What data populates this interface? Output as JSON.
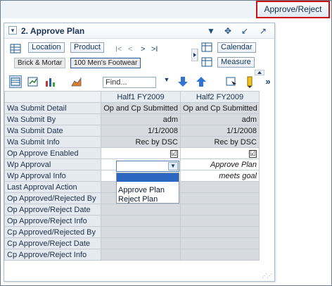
{
  "top_bar": {
    "approve_reject_label": "Approve/Reject"
  },
  "panel": {
    "title": "2. Approve Plan",
    "toolbar": {
      "location_label": "Location",
      "product_label": "Product",
      "calendar_label": "Calendar",
      "measure_label": "Measure",
      "context_chips": [
        "Brick & Mortar",
        "100 Men's Footwear"
      ],
      "find_placeholder": "Find..."
    },
    "grid": {
      "columns": [
        "Half1 FY2009",
        "Half2 FY2009"
      ],
      "rows": [
        {
          "label": "Wa Submit Detail",
          "cells": [
            "Op and Cp Submitted",
            "Op and Cp Submitted"
          ]
        },
        {
          "label": "Wa Submit By",
          "cells": [
            "adm",
            "adm"
          ]
        },
        {
          "label": "Wa Submit Date",
          "cells": [
            "1/1/2008",
            "1/1/2008"
          ]
        },
        {
          "label": "Wa Submit Info",
          "cells": [
            "Rec by DSC",
            "Rec by DSC"
          ]
        },
        {
          "label": "Op Approve Enabled",
          "cells": [
            "☑",
            "☑"
          ]
        },
        {
          "label": "Wp Approval",
          "cells": [
            "",
            "Approve Plan"
          ]
        },
        {
          "label": "Wp Approval Info",
          "cells": [
            "",
            "meets goal"
          ]
        },
        {
          "label": "Last Approval Action",
          "cells": [
            "",
            ""
          ]
        },
        {
          "label": "Op Approved/Rejected By",
          "cells": [
            "",
            ""
          ]
        },
        {
          "label": "Op Approve/Reject Date",
          "cells": [
            "",
            ""
          ]
        },
        {
          "label": "Op Approve/Reject Info",
          "cells": [
            "",
            ""
          ]
        },
        {
          "label": "Cp Approved/Rejected By",
          "cells": [
            "",
            ""
          ]
        },
        {
          "label": "Cp Approve/Reject Date",
          "cells": [
            "",
            ""
          ]
        },
        {
          "label": "Cp Approve/Reject Info",
          "cells": [
            "",
            ""
          ]
        }
      ]
    },
    "dropdown_options": [
      "Approve Plan",
      "Reject Plan"
    ]
  }
}
